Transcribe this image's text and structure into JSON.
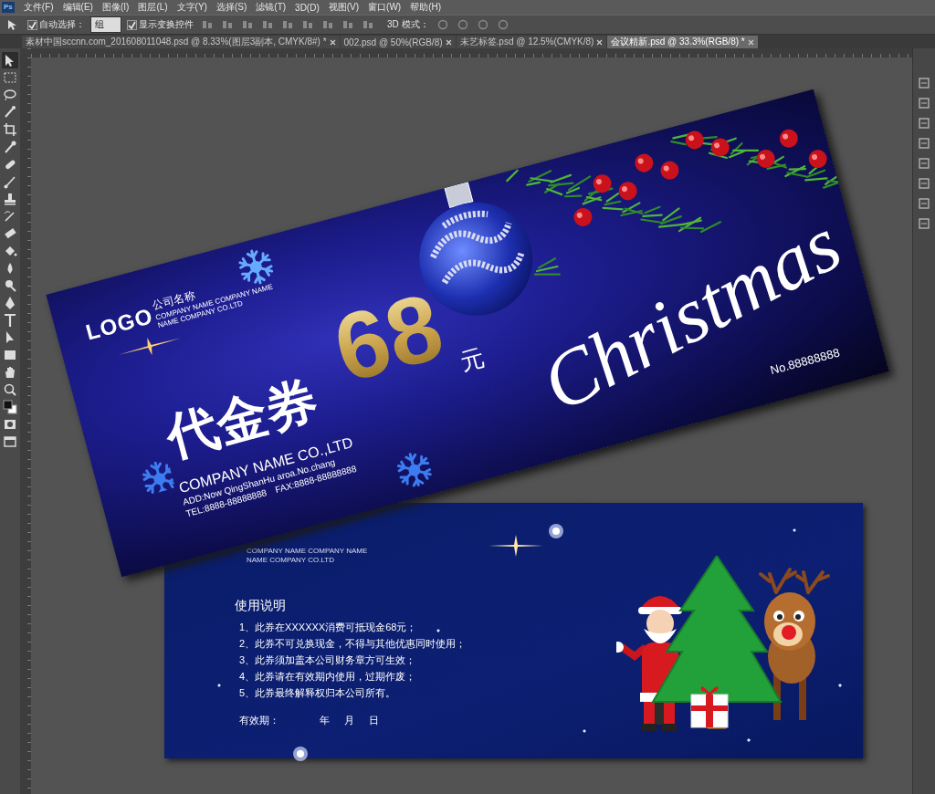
{
  "app": {
    "logo": "Ps"
  },
  "menu": [
    "文件(F)",
    "编辑(E)",
    "图像(I)",
    "图层(L)",
    "文字(Y)",
    "选择(S)",
    "滤镜(T)",
    "3D(D)",
    "视图(V)",
    "窗口(W)",
    "帮助(H)"
  ],
  "options_bar": {
    "auto_select": {
      "label": "自动选择：",
      "checked": true
    },
    "select_target": "组",
    "show_transform": {
      "label": "显示变换控件",
      "checked": true
    },
    "mode_3d": "3D 模式："
  },
  "tabs": [
    {
      "label": "素材中国sccnn.com_201608011048.psd @ 8.33%(图层3副本, CMYK/8#) *",
      "selected": false
    },
    {
      "label": "002.psd @ 50%(RGB/8)",
      "selected": false
    },
    {
      "label": "未艺标签.psd @ 12.5%(CMYK/8)",
      "selected": false
    },
    {
      "label": "会议精新.psd @ 33.3%(RGB/8) *",
      "selected": true
    }
  ],
  "front_voucher": {
    "logo": "LOGO",
    "company_cn": "公司名称",
    "company_en_1": "COMPANY NAME COMPANY NAME",
    "company_en_2": "NAME COMPANY CO.LTD",
    "title": "代金券",
    "amount": "68",
    "unit": "元",
    "script": "Christmas",
    "number": "No.88888888",
    "company": "COMPANY NAME CO.,LTD",
    "address": "ADD:Now QingShanHu aroa.No.chang",
    "tel": "TEL:8888-88888888",
    "fax": "FAX:8888-88888888"
  },
  "back_voucher": {
    "company_en_1": "COMPANY NAME COMPANY NAME",
    "company_en_2": "NAME COMPANY CO.LTD",
    "instructions_title": "使用说明",
    "rules": [
      "1、此券在XXXXXX消费可抵现金68元；",
      "2、此券不可兑换现金，不得与其他优惠同时使用；",
      "3、此券须加盖本公司财务章方可生效；",
      "4、此券请在有效期内使用，过期作废；",
      "5、此券最终解释权归本公司所有。"
    ],
    "validity": {
      "label": "有效期：",
      "year": "年",
      "month": "月",
      "day": "日"
    }
  }
}
